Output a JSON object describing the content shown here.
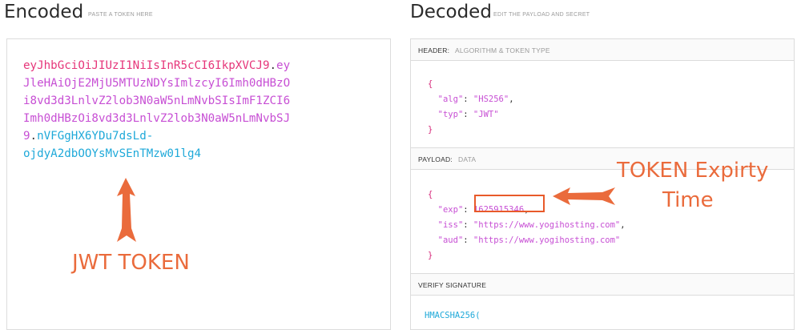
{
  "encoded": {
    "title": "Encoded",
    "subtitle": "PASTE A TOKEN HERE",
    "token_lines": [
      {
        "parts": [
          {
            "cls": "t-hdr",
            "text": "eyJhbGciOiJIUzI1NiIsInR5cCI6IkpXVCJ9"
          },
          {
            "cls": "t-dot",
            "text": "."
          },
          {
            "cls": "t-pay",
            "text": "ey"
          }
        ]
      },
      {
        "parts": [
          {
            "cls": "t-pay",
            "text": "JleHAiOjE2MjU5MTUzNDYsImlzcyI6Imh0dHBzO"
          }
        ]
      },
      {
        "parts": [
          {
            "cls": "t-pay",
            "text": "i8vd3d3LnlvZ2lob3N0aW5nLmNvbSIsImF1ZCI6"
          }
        ]
      },
      {
        "parts": [
          {
            "cls": "t-pay",
            "text": "Imh0dHBzOi8vd3d3LnlvZ2lob3N0aW5nLmNvbSJ"
          }
        ]
      },
      {
        "parts": [
          {
            "cls": "t-pay",
            "text": "9"
          },
          {
            "cls": "t-dot",
            "text": "."
          },
          {
            "cls": "t-sig",
            "text": "nVFGgHX6YDu7dsLd-"
          }
        ]
      },
      {
        "parts": [
          {
            "cls": "t-sig",
            "text": "ojdyA2dbOOYsMvSEnTMzw01lg4"
          }
        ]
      }
    ]
  },
  "decoded": {
    "title": "Decoded",
    "subtitle": "EDIT THE PAYLOAD AND SECRET",
    "header_section": {
      "label": "HEADER:",
      "sublabel": "ALGORITHM & TOKEN TYPE"
    },
    "header_json": {
      "alg_key": "\"alg\"",
      "alg_val": "\"HS256\"",
      "typ_key": "\"typ\"",
      "typ_val": "\"JWT\""
    },
    "payload_section": {
      "label": "PAYLOAD:",
      "sublabel": "DATA"
    },
    "payload_json": {
      "exp_key": "\"exp\"",
      "exp_val": "1625915346",
      "iss_key": "\"iss\"",
      "iss_val": "\"https://www.yogihosting.com\"",
      "aud_key": "\"aud\"",
      "aud_val": "\"https://www.yogihosting.com\""
    },
    "verify_section": {
      "label": "VERIFY SIGNATURE"
    },
    "verify_code": "HMACSHA256("
  },
  "annotations": {
    "jwt_token": "JWT TOKEN",
    "expiry_line1": "TOKEN Expirty",
    "expiry_line2": "Time",
    "color": "#ea6b3c"
  }
}
